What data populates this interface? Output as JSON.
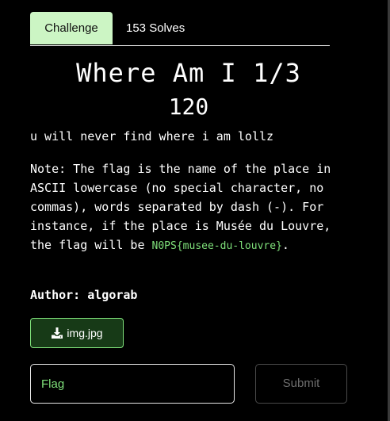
{
  "tabs": {
    "challenge_label": "Challenge",
    "solves_label": "153 Solves"
  },
  "challenge": {
    "title": "Where Am I 1/3",
    "points": "120",
    "description": "u will never find where i am lollz",
    "note_text": "Note: The flag is the name of the place in ASCII lowercase (no special character, no commas), words separated by dash (-). For instance, if the place is Musée du Louvre, the flag will be ",
    "flag_example": "N0PS{musee-du-louvre}",
    "note_end": ".",
    "author": "Author: algorab"
  },
  "attachment": {
    "label": "img.jpg",
    "icon": "download-icon"
  },
  "submission": {
    "placeholder": "Flag",
    "value": "",
    "submit_label": "Submit"
  },
  "colors": {
    "background": "#000000",
    "accent_green": "#7fe07a",
    "tab_active_bg": "#ccf5c4"
  }
}
